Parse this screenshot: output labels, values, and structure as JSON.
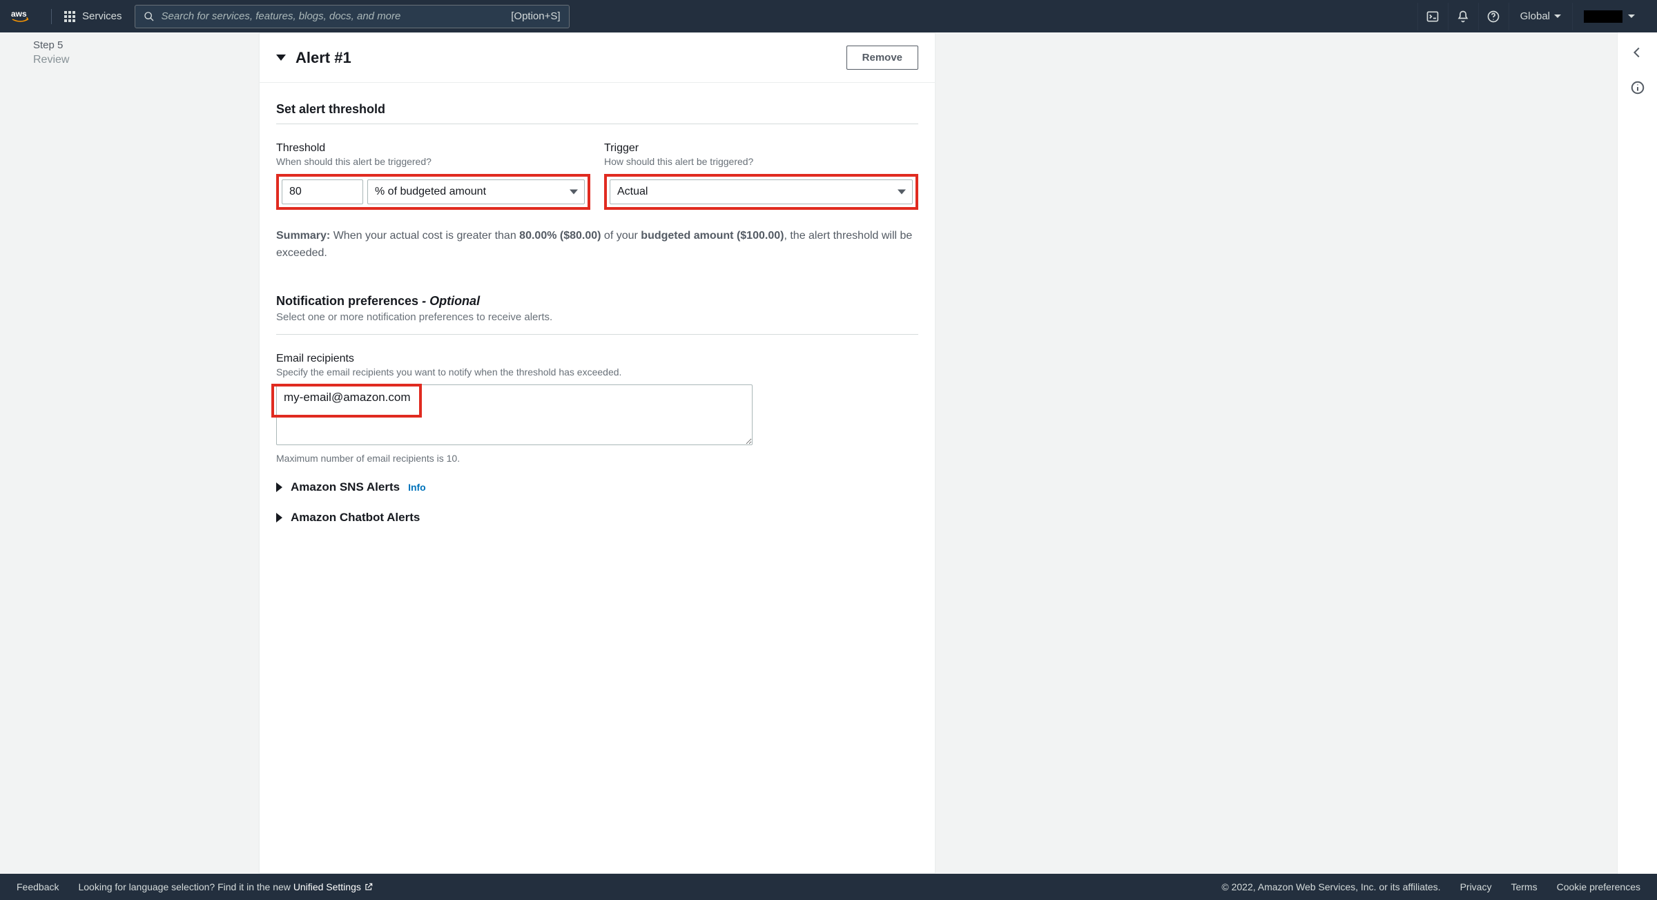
{
  "topnav": {
    "services": "Services",
    "search_placeholder": "Search for services, features, blogs, docs, and more",
    "search_hint": "[Option+S]",
    "region": "Global"
  },
  "sidebar": {
    "step_label": "Step 5",
    "step_title": "Review"
  },
  "alert": {
    "title": "Alert #1",
    "remove": "Remove",
    "threshold_section": "Set alert threshold",
    "threshold_label": "Threshold",
    "threshold_help": "When should this alert be triggered?",
    "threshold_value": "80",
    "threshold_unit": "% of budgeted amount",
    "trigger_label": "Trigger",
    "trigger_help": "How should this alert be triggered?",
    "trigger_value": "Actual",
    "summary": {
      "prefix": "Summary:",
      "p1": " When your actual cost is greater than ",
      "percent": "80.00% ($80.00)",
      "p2": " of your ",
      "budget": "budgeted amount ($100.00)",
      "p3": ", the alert threshold will be exceeded."
    },
    "notif_heading": "Notification preferences",
    "notif_optional": "- Optional",
    "notif_desc": "Select one or more notification preferences to receive alerts.",
    "email_heading": "Email recipients",
    "email_help": "Specify the email recipients you want to notify when the threshold has exceeded.",
    "email_value": "my-email@amazon.com",
    "email_limit": "Maximum number of email recipients is 10.",
    "sns_label": "Amazon SNS Alerts",
    "sns_info": "Info",
    "chatbot_label": "Amazon Chatbot Alerts"
  },
  "footer": {
    "feedback": "Feedback",
    "lang_prompt": "Looking for language selection? Find it in the new ",
    "unified": "Unified Settings",
    "copyright": "© 2022, Amazon Web Services, Inc. or its affiliates.",
    "privacy": "Privacy",
    "terms": "Terms",
    "cookie": "Cookie preferences"
  }
}
